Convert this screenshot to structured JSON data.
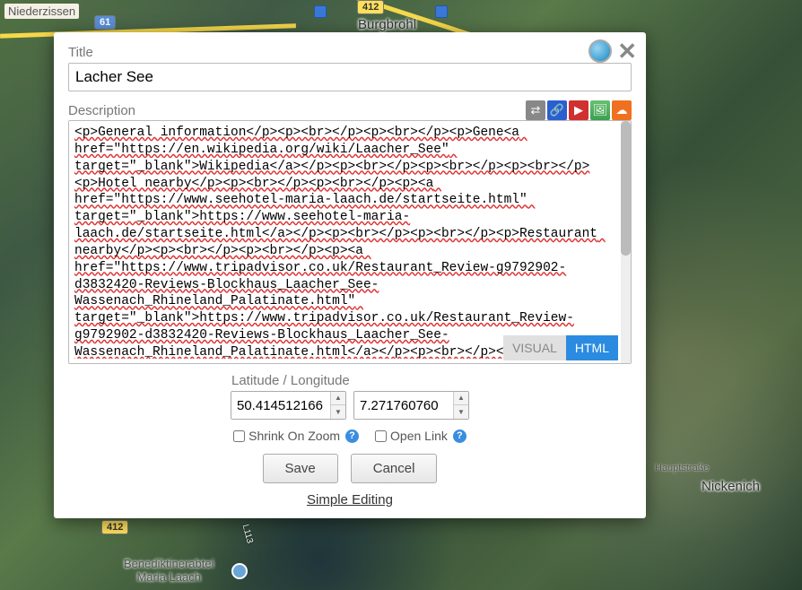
{
  "map": {
    "labels": {
      "niederzissen": "Niederzissen",
      "burgbrohl": "Burgbrohl",
      "nickenich": "Nickenich",
      "hauptstrasse": "Hauptstraße",
      "benedikt1": "Benediktinerabtei",
      "benedikt2": "Maria Laach",
      "road61": "61",
      "road412": "412",
      "l113": "L113"
    }
  },
  "modal": {
    "title_label": "Title",
    "title_value": "Lacher See",
    "desc_label": "Description",
    "desc_value": "<p>General information</p><p><br></p><p><br></p><p>Gene<a href=\"https://en.wikipedia.org/wiki/Laacher_See\" target=\"_blank\">Wikipedia</a></p><p><br></p><p><br></p><p><br></p>\n<p>Hotel nearby</p><p><br></p><p><br></p><p><a href=\"https://www.seehotel-maria-laach.de/startseite.html\" target=\"_blank\">https://www.seehotel-maria-laach.de/startseite.html</a></p><p><br></p><p><br></p><p>Restaurant nearby</p><p><br></p><p><br></p><p><a href=\"https://www.tripadvisor.co.uk/Restaurant_Review-g9792902-d3832420-Reviews-Blockhaus_Laacher_See-Wassenach_Rhineland_Palatinate.html\" target=\"_blank\">https://www.tripadvisor.co.uk/Restaurant_Review-g9792902-d3832420-Reviews-Blockhaus_Laacher_See-Wassenach_Rhineland_Palatinate.html</a></p><p><br></p><p>",
    "mode_visual": "VISUAL",
    "mode_html": "HTML",
    "latlng_label": "Latitude / Longitude",
    "lat_value": "50.414512166",
    "lng_value": "7.271760760",
    "shrink_label": "Shrink On Zoom",
    "open_link_label": "Open Link",
    "shrink_checked": false,
    "open_link_checked": false,
    "save_label": "Save",
    "cancel_label": "Cancel",
    "simple_link": "Simple Editing",
    "close_glyph": "✕",
    "help_glyph": "?",
    "toolbar": {
      "route": "⇄",
      "link": "🔗",
      "youtube": "▶",
      "image": "🖼",
      "sound": "☁"
    }
  }
}
